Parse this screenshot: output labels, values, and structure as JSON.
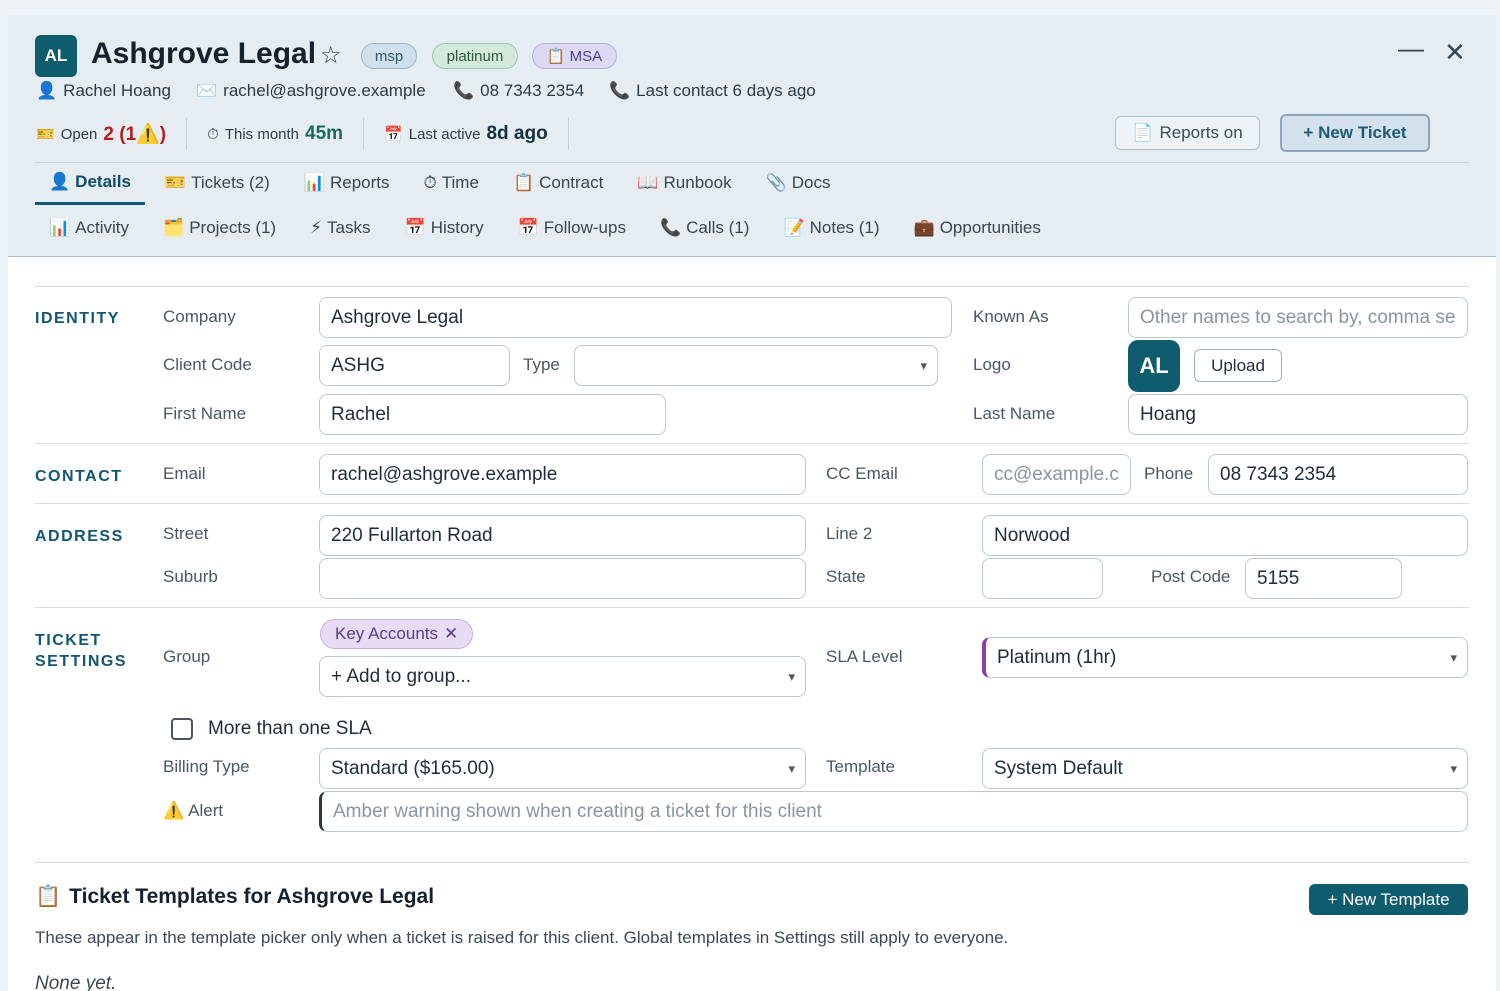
{
  "header": {
    "avatar": "AL",
    "title": "Ashgrove Legal",
    "star_icon": "☆",
    "tags": {
      "msp": "msp",
      "platinum": "platinum",
      "msa": "MSA",
      "msa_icon": "📋"
    },
    "minimize_icon": "—",
    "close_icon": "✕",
    "contact": {
      "person_icon": "👤",
      "person": "Rachel Hoang",
      "email_icon": "✉️",
      "email": "rachel@ashgrove.example",
      "phone_icon": "📞",
      "phone": "08 7343 2354",
      "last_contact_icon": "📞",
      "last_contact": "Last contact 6 days ago"
    },
    "stats": {
      "open_icon": "🎫",
      "open_label": "Open",
      "open_value": "2 (1⚠️)",
      "month_icon": "⏱",
      "month_label": "This month",
      "month_value": "45m",
      "active_icon": "📅",
      "active_label": "Last active",
      "active_value": "8d ago"
    },
    "reports_button": "Reports on",
    "reports_icon": "📄",
    "new_ticket_button": "+ New Ticket"
  },
  "tabs_row1": [
    {
      "icon": "👤",
      "label": "Details"
    },
    {
      "icon": "🎫",
      "label": "Tickets (2)"
    },
    {
      "icon": "📊",
      "label": "Reports"
    },
    {
      "icon": "⏱",
      "label": "Time"
    },
    {
      "icon": "📋",
      "label": "Contract"
    },
    {
      "icon": "📖",
      "label": "Runbook"
    },
    {
      "icon": "📎",
      "label": "Docs"
    }
  ],
  "tabs_row2": [
    {
      "icon": "📊",
      "label": "Activity"
    },
    {
      "icon": "🗂️",
      "label": "Projects (1)"
    },
    {
      "icon": "⚡",
      "label": "Tasks"
    },
    {
      "icon": "📅",
      "label": "History"
    },
    {
      "icon": "📅",
      "label": "Follow-ups"
    },
    {
      "icon": "📞",
      "label": "Calls (1)"
    },
    {
      "icon": "📝",
      "label": "Notes (1)"
    },
    {
      "icon": "💼",
      "label": "Opportunities"
    }
  ],
  "identity": {
    "section": "IDENTITY",
    "company_label": "Company",
    "company_value": "Ashgrove Legal",
    "known_as_label": "Known As",
    "known_as_placeholder": "Other names to search by, comma se",
    "client_code_label": "Client Code",
    "client_code_value": "ASHG",
    "type_label": "Type",
    "type_value": "",
    "logo_label": "Logo",
    "logo_avatar": "AL",
    "upload_button": "Upload",
    "first_name_label": "First Name",
    "first_name_value": "Rachel",
    "last_name_label": "Last Name",
    "last_name_value": "Hoang"
  },
  "contact": {
    "section": "CONTACT",
    "email_label": "Email",
    "email_value": "rachel@ashgrove.example",
    "cc_label": "CC Email",
    "cc_placeholder": "cc@example.c",
    "phone_label": "Phone",
    "phone_value": "08 7343 2354"
  },
  "address": {
    "section": "ADDRESS",
    "street_label": "Street",
    "street_value": "220 Fullarton Road",
    "line2_label": "Line 2",
    "line2_value": "Norwood",
    "suburb_label": "Suburb",
    "suburb_value": "",
    "state_label": "State",
    "state_value": "",
    "postcode_label": "Post Code",
    "postcode_value": "5155"
  },
  "ticket_settings": {
    "section_line1": "TICKET",
    "section_line2": "SETTINGS",
    "group_label": "Group",
    "group_tag": "Key Accounts",
    "group_tag_remove": "✕",
    "add_group": "+ Add to group...",
    "sla_label": "SLA Level",
    "sla_value": "Platinum (1hr)",
    "multi_sla_label": "More than one SLA",
    "billing_label": "Billing Type",
    "billing_value": "Standard ($165.00)",
    "template_label": "Template",
    "template_value": "System Default",
    "alert_icon": "⚠️",
    "alert_label": "Alert",
    "alert_placeholder": "Amber warning shown when creating a ticket for this client"
  },
  "templates": {
    "icon": "📋",
    "title": "Ticket Templates for Ashgrove Legal",
    "new_button": "+ New Template",
    "description": "These appear in the template picker only when a ticket is raised for this client. Global templates in Settings still apply to everyone.",
    "empty": "None yet."
  }
}
